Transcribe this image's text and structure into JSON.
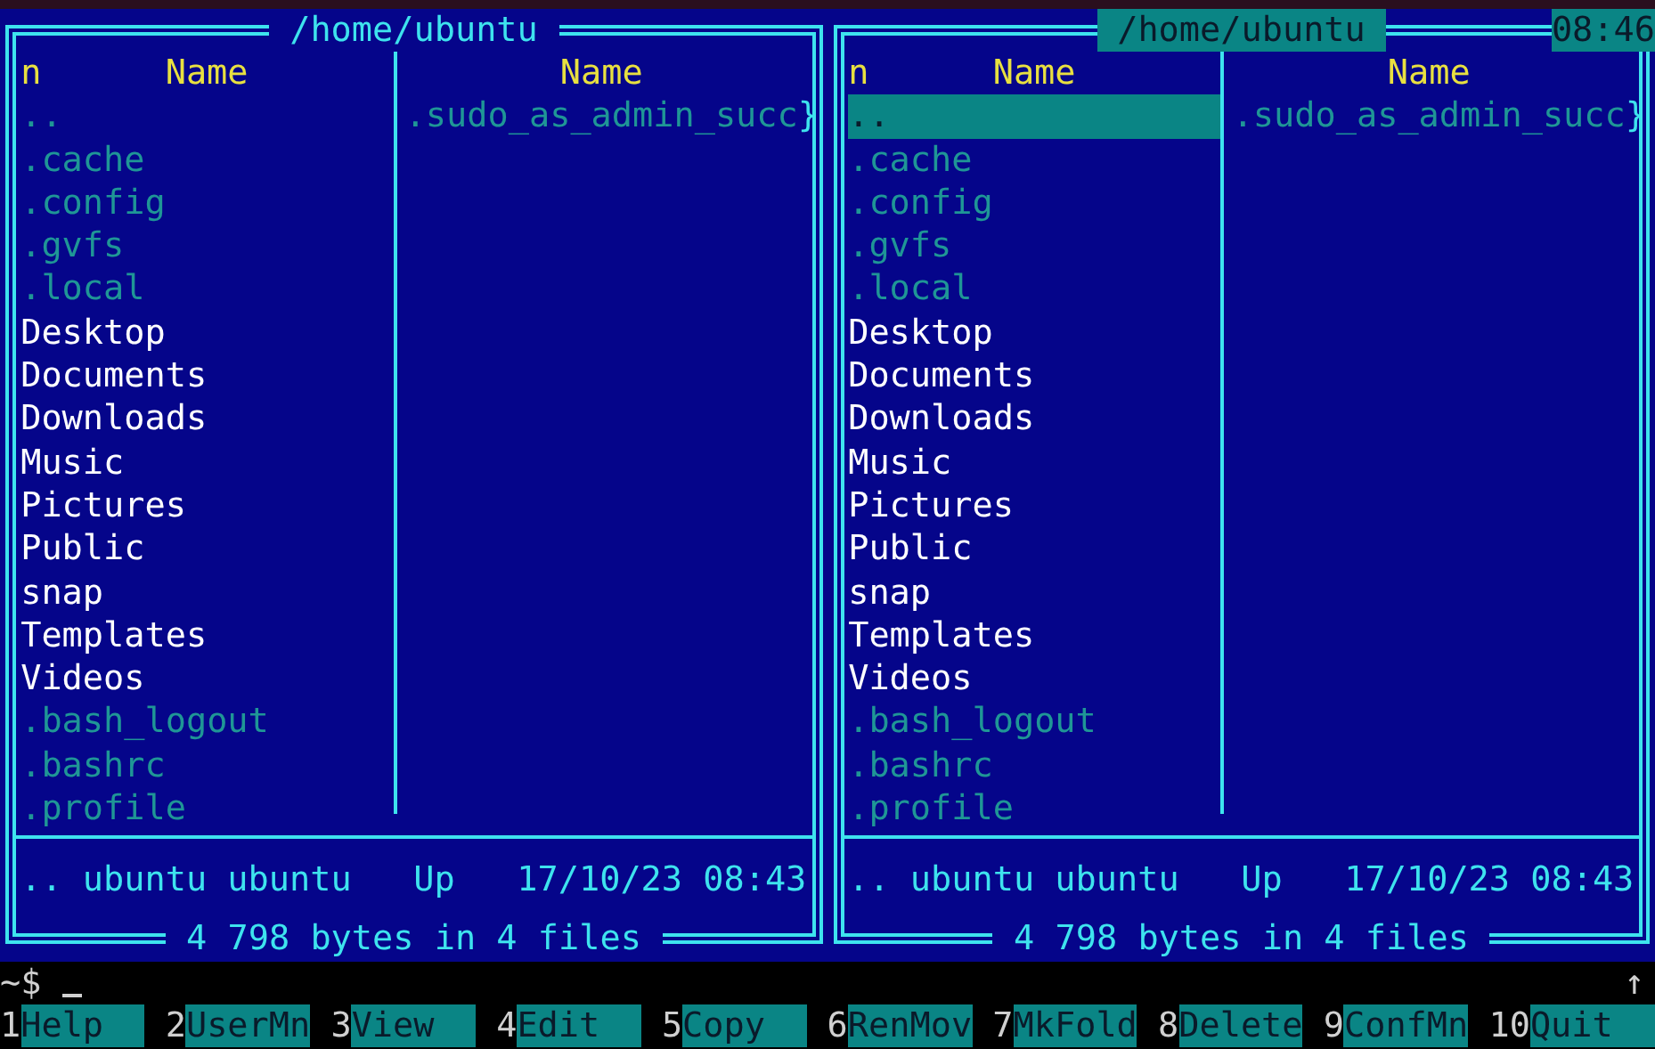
{
  "panels": [
    {
      "path": "/home/ubuntu",
      "active": false,
      "sort_mark": "n",
      "columns": [
        "Name",
        "Name"
      ],
      "files": [
        {
          "name": "..",
          "hidden": true,
          "selected": false
        },
        {
          "name": ".cache",
          "hidden": true,
          "selected": false
        },
        {
          "name": ".config",
          "hidden": true,
          "selected": false
        },
        {
          "name": ".gvfs",
          "hidden": true,
          "selected": false
        },
        {
          "name": ".local",
          "hidden": true,
          "selected": false
        },
        {
          "name": "Desktop",
          "hidden": false,
          "selected": false
        },
        {
          "name": "Documents",
          "hidden": false,
          "selected": false
        },
        {
          "name": "Downloads",
          "hidden": false,
          "selected": false
        },
        {
          "name": "Music",
          "hidden": false,
          "selected": false
        },
        {
          "name": "Pictures",
          "hidden": false,
          "selected": false
        },
        {
          "name": "Public",
          "hidden": false,
          "selected": false
        },
        {
          "name": "snap",
          "hidden": false,
          "selected": false
        },
        {
          "name": "Templates",
          "hidden": false,
          "selected": false
        },
        {
          "name": "Videos",
          "hidden": false,
          "selected": false
        },
        {
          "name": ".bash_logout",
          "hidden": true,
          "selected": false
        },
        {
          "name": ".bashrc",
          "hidden": true,
          "selected": false
        },
        {
          "name": ".profile",
          "hidden": true,
          "selected": false
        }
      ],
      "column_2": [
        {
          "name": ".sudo_as_admin_succ",
          "hidden": true,
          "overflow_mark": "}"
        }
      ],
      "info": [
        "..",
        "ubuntu",
        "ubuntu",
        "Up",
        "17/10/23",
        "08:43"
      ],
      "summary": "4 798 bytes in 4 files"
    },
    {
      "path": "/home/ubuntu",
      "active": true,
      "sort_mark": "n",
      "columns": [
        "Name",
        "Name"
      ],
      "files": [
        {
          "name": "..",
          "hidden": true,
          "selected": true
        },
        {
          "name": ".cache",
          "hidden": true,
          "selected": false
        },
        {
          "name": ".config",
          "hidden": true,
          "selected": false
        },
        {
          "name": ".gvfs",
          "hidden": true,
          "selected": false
        },
        {
          "name": ".local",
          "hidden": true,
          "selected": false
        },
        {
          "name": "Desktop",
          "hidden": false,
          "selected": false
        },
        {
          "name": "Documents",
          "hidden": false,
          "selected": false
        },
        {
          "name": "Downloads",
          "hidden": false,
          "selected": false
        },
        {
          "name": "Music",
          "hidden": false,
          "selected": false
        },
        {
          "name": "Pictures",
          "hidden": false,
          "selected": false
        },
        {
          "name": "Public",
          "hidden": false,
          "selected": false
        },
        {
          "name": "snap",
          "hidden": false,
          "selected": false
        },
        {
          "name": "Templates",
          "hidden": false,
          "selected": false
        },
        {
          "name": "Videos",
          "hidden": false,
          "selected": false
        },
        {
          "name": ".bash_logout",
          "hidden": true,
          "selected": false
        },
        {
          "name": ".bashrc",
          "hidden": true,
          "selected": false
        },
        {
          "name": ".profile",
          "hidden": true,
          "selected": false
        }
      ],
      "column_2": [
        {
          "name": ".sudo_as_admin_succ",
          "hidden": true,
          "overflow_mark": "}"
        }
      ],
      "info": [
        "..",
        "ubuntu",
        "ubuntu",
        "Up",
        "17/10/23",
        "08:43"
      ],
      "summary": "4 798 bytes in 4 files"
    }
  ],
  "clock": "08:46",
  "command_line": {
    "prompt": "~$",
    "scroll_mark": "↑"
  },
  "keys": [
    {
      "number": "1",
      "label": "Help"
    },
    {
      "number": "2",
      "label": "UserMn"
    },
    {
      "number": "3",
      "label": "View"
    },
    {
      "number": "4",
      "label": "Edit"
    },
    {
      "number": "5",
      "label": "Copy"
    },
    {
      "number": "6",
      "label": "RenMov"
    },
    {
      "number": "7",
      "label": "MkFold"
    },
    {
      "number": "8",
      "label": "Delete"
    },
    {
      "number": "9",
      "label": "ConfMn"
    },
    {
      "number": "10",
      "label": "Quit"
    }
  ]
}
